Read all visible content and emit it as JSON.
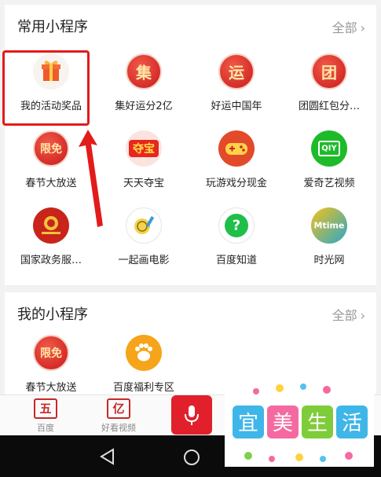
{
  "frequent": {
    "title": "常用小程序",
    "see_all": "全部",
    "items": [
      {
        "label": "我的活动奖品",
        "icon": "gift-icon",
        "glyph": ""
      },
      {
        "label": "集好运分2亿",
        "icon": "ji-seal-icon",
        "glyph": "集"
      },
      {
        "label": "好运中国年",
        "icon": "yun-seal-icon",
        "glyph": "运"
      },
      {
        "label": "团圆红包分…",
        "icon": "tuan-seal-icon",
        "glyph": "团"
      },
      {
        "label": "春节大放送",
        "icon": "xianmian-icon",
        "glyph": "限免"
      },
      {
        "label": "天天夺宝",
        "icon": "duobao-icon",
        "glyph": "夺宝"
      },
      {
        "label": "玩游戏分现金",
        "icon": "gamepad-icon",
        "glyph": ""
      },
      {
        "label": "爱奇艺视频",
        "icon": "iqiyi-icon",
        "glyph": "QIY"
      },
      {
        "label": "国家政务服…",
        "icon": "national-emblem-icon",
        "glyph": ""
      },
      {
        "label": "一起画电影",
        "icon": "film-drawing-icon",
        "glyph": ""
      },
      {
        "label": "百度知道",
        "icon": "question-icon",
        "glyph": "?"
      },
      {
        "label": "时光网",
        "icon": "mtime-icon",
        "glyph": "Mtime"
      }
    ]
  },
  "mine": {
    "title": "我的小程序",
    "see_all": "全部",
    "items": [
      {
        "label": "春节大放送",
        "icon": "xianmian-icon",
        "glyph": "限免"
      },
      {
        "label": "百度福利专区",
        "icon": "paw-icon",
        "glyph": ""
      }
    ]
  },
  "bottom_tabs": [
    {
      "label": "百度",
      "glyph": "五",
      "icon": "baidu-icon"
    },
    {
      "label": "好看视频",
      "glyph": "亿",
      "icon": "haokan-icon"
    }
  ],
  "watermark": {
    "text": "宜美生活",
    "chars": [
      "宜",
      "美",
      "生",
      "活"
    ]
  },
  "colors": {
    "accent_red": "#e2202b",
    "highlight": "#e21b1b",
    "muted": "#999999"
  }
}
